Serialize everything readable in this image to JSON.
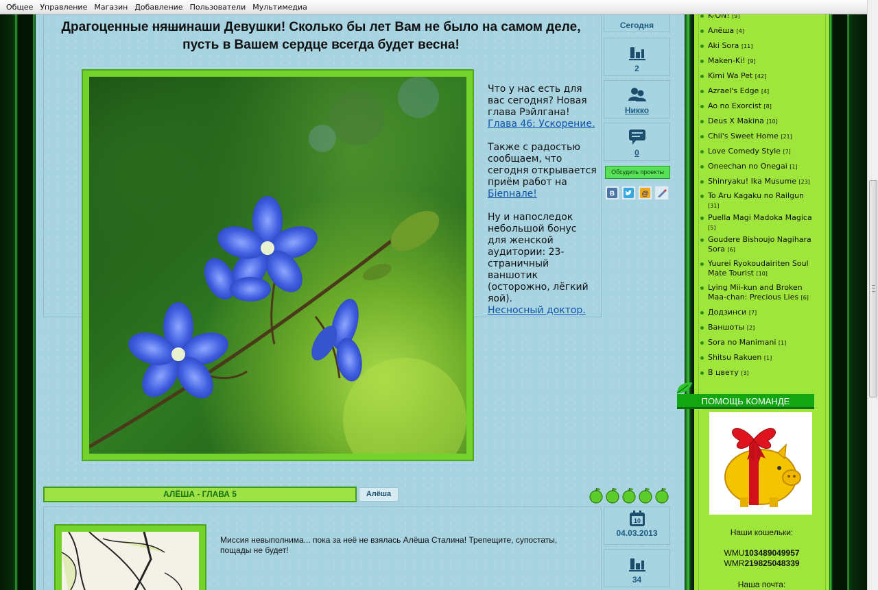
{
  "topbar": {
    "items": [
      "Общее",
      "Управление",
      "Магазин",
      "Добавление",
      "Пользователи",
      "Мультимедиа"
    ]
  },
  "post1": {
    "title_part1": "Драгоценные ",
    "title_strike": "няши",
    "title_part2": "наши Девушки! Сколько бы лет Вам не было на самом деле, пусть в Вашем сердце всегда будет весна!",
    "para1_text": "Что у нас есть для вас сегодня? Новая глава Рэйлгана!",
    "para1_link": "Глава 46: Ускорение.",
    "para2_text": "Также с радостью сообщаем, что сегодня открывается приём работ на",
    "para2_link": "Бienнале!",
    "para3_text": "Ну и напоследок небольшой бонус для женской аудитории: 23-страничный ваншотик (осторожно, лёгкий яой).",
    "para3_link": "Несносный доктор.",
    "meta_date": "Сегодня",
    "meta_views": "2",
    "meta_author": "Никко",
    "meta_comments": "0",
    "discuss_label": "Обсудить проекты",
    "share_icons": [
      "vk-icon",
      "twitter-icon",
      "mail-icon",
      "lj-icon"
    ]
  },
  "post2": {
    "title": "АЛЁША - ГЛАВА 5",
    "author_button": "Алёша",
    "rating": 5,
    "text": "Миссия невыполнима... пока за неё не взялась Алёша Сталина! Трепещите, супостаты, пощады не будет!",
    "date_day": "10",
    "date": "04.03.2013",
    "views": "34"
  },
  "sidebar": {
    "categories": [
      {
        "name": "K-ON!",
        "count": "[9]"
      },
      {
        "name": "Алёша",
        "count": "[4]"
      },
      {
        "name": "Aki Sora",
        "count": "[11]"
      },
      {
        "name": "Maken-Ki!",
        "count": "[9]"
      },
      {
        "name": "Kimi Wa Pet",
        "count": "[42]"
      },
      {
        "name": "Azrael's Edge",
        "count": "[4]"
      },
      {
        "name": "Ao no Exorcist",
        "count": "[8]"
      },
      {
        "name": "Deus X Makina",
        "count": "[10]"
      },
      {
        "name": "Chii's Sweet Home",
        "count": "[21]"
      },
      {
        "name": "Love Comedy Style",
        "count": "[7]"
      },
      {
        "name": "Oneechan no Onegai",
        "count": "[1]"
      },
      {
        "name": "Shinryaku! Ika Musume",
        "count": "[23]"
      },
      {
        "name": "To Aru Kagaku no Railgun",
        "count": "[31]"
      },
      {
        "name": "Puella Magi Madoka Magica",
        "count": "[5]"
      },
      {
        "name": "Goudere Bishoujo Nagihara Sora",
        "count": "[6]"
      },
      {
        "name": "Yuurei Ryokoudairiten Soul Mate Tourist",
        "count": "[10]"
      },
      {
        "name": "Lying Mii-kun and Broken Maa-chan: Precious Lies",
        "count": "[6]"
      },
      {
        "name": "Додзинси",
        "count": "[7]"
      },
      {
        "name": "Ваншоты",
        "count": "[2]"
      },
      {
        "name": "Sora no Manimani",
        "count": "[1]"
      },
      {
        "name": "Shitsu Rakuen",
        "count": "[1]"
      },
      {
        "name": "В цвету",
        "count": "[3]"
      }
    ],
    "help_title": "ПОМОЩЬ КОМАНДЕ",
    "wallets_title": "Наши кошельки:",
    "wmu_label": "WMU",
    "wmu_value": "103489049957",
    "wmr_label": "WMR",
    "wmr_value": "219825048339",
    "mail_title": "Наша почта:"
  },
  "colors": {
    "main_bg": "#a8d3e1",
    "sidebar_bg": "#9fe63c",
    "accent_green": "#13a613",
    "link_blue": "#1155aa"
  }
}
